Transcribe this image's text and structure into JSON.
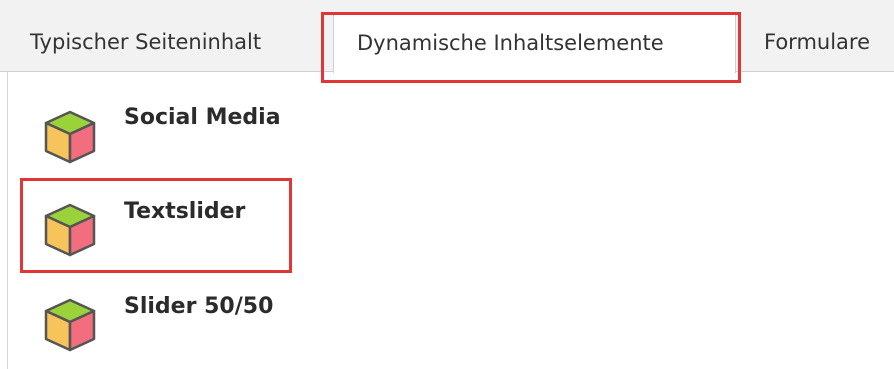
{
  "tabs": [
    {
      "label": "Typischer Seiteninhalt",
      "active": false
    },
    {
      "label": "Dynamische Inhaltselemente",
      "active": true
    },
    {
      "label": "Formulare",
      "active": false
    }
  ],
  "items": [
    {
      "label": "Social Media",
      "icon": "content-element-cube-icon"
    },
    {
      "label": "Textslider",
      "icon": "content-element-cube-icon"
    },
    {
      "label": "Slider 50/50",
      "icon": "content-element-cube-icon"
    }
  ],
  "colors": {
    "highlight": "#e23636",
    "cube_top": "#9bd23a",
    "cube_left": "#f7c35b",
    "cube_right": "#f26d7d",
    "cube_outline": "#555555"
  }
}
